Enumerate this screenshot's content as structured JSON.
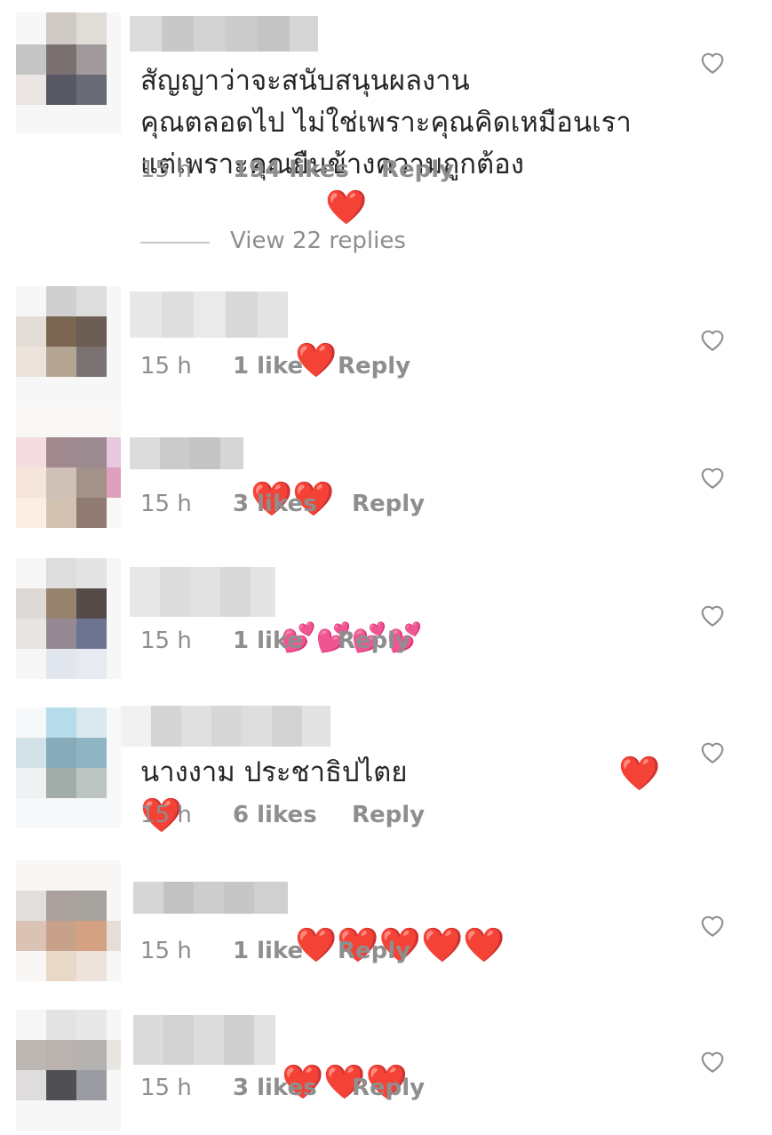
{
  "like_icon": "heart-outline-icon",
  "colors": {
    "text": "#262626",
    "meta": "#8e8e8e",
    "heart": "#e0162b"
  },
  "comments": [
    {
      "text": "สัญญาว่าจะสนับสนุนผลงาน\nคุณตลอดไป ไม่ใช่เพราะคุณคิดเหมือนเรา\nแต่เพราะคุณยืนข้างความถูกต้อง",
      "emoji": "❤️",
      "time": "15 h",
      "likes": "194 likes",
      "reply": "Reply",
      "view_replies": "View 22 replies"
    },
    {
      "text": "",
      "emoji": "❤️",
      "time": "15 h",
      "likes": "1 like",
      "reply": "Reply"
    },
    {
      "text": "",
      "emoji": "❤️❤️",
      "time": "15 h",
      "likes": "3 likes",
      "reply": "Reply"
    },
    {
      "text": "",
      "emoji": "💕💕💕💕",
      "time": "15 h",
      "likes": "1 like",
      "reply": "Reply"
    },
    {
      "text": "นางงาม ประชาธิปไตย",
      "emoji": "❤️",
      "emoji2": "❤️",
      "time": "15 h",
      "likes": "6 likes",
      "reply": "Reply"
    },
    {
      "text": "",
      "emoji": "❤️❤️❤️❤️❤️",
      "time": "15 h",
      "likes": "1 like",
      "reply": "Reply"
    },
    {
      "text": "",
      "emoji": "❤️❤️❤️",
      "time": "15 h",
      "likes": "3 likes",
      "reply": "Reply"
    }
  ]
}
